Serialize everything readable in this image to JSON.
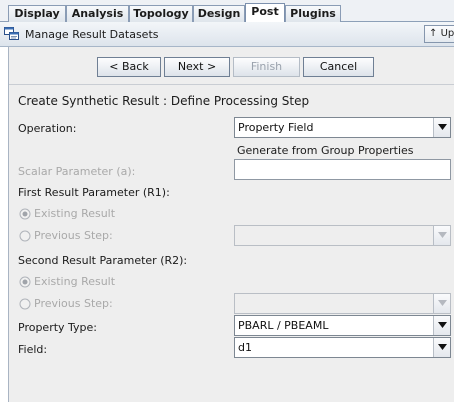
{
  "tabs": [
    {
      "label": "Display"
    },
    {
      "label": "Analysis"
    },
    {
      "label": "Topology"
    },
    {
      "label": "Design"
    },
    {
      "label": "Post"
    },
    {
      "label": "Plugins"
    }
  ],
  "header": {
    "title": "Manage Result Datasets",
    "up_label": "Up",
    "up_icon": "up-arrow-icon"
  },
  "wizard": {
    "back_label": "< Back",
    "next_label": "Next >",
    "finish_label": "Finish",
    "cancel_label": "Cancel"
  },
  "form": {
    "section_title": "Create Synthetic Result : Define Processing Step",
    "operation_label": "Operation:",
    "operation_value": "Property Field",
    "generate_note": "Generate from Group Properties",
    "scalar_label": "Scalar Parameter (a):",
    "scalar_value": "",
    "first_label": "First Result Parameter (R1):",
    "first_existing": "Existing Result",
    "first_previous": "Previous Step:",
    "second_label": "Second Result Parameter (R2):",
    "second_existing": "Existing Result",
    "second_previous": "Previous Step:",
    "property_type_label": "Property Type:",
    "property_type_value": "PBARL / PBEAML",
    "field_label": "Field:",
    "field_value": "d1"
  },
  "colors": {
    "panel_bg": "#eeeeee",
    "tab_border": "#8a9cb5",
    "disabled_text": "#a9a9a9"
  }
}
